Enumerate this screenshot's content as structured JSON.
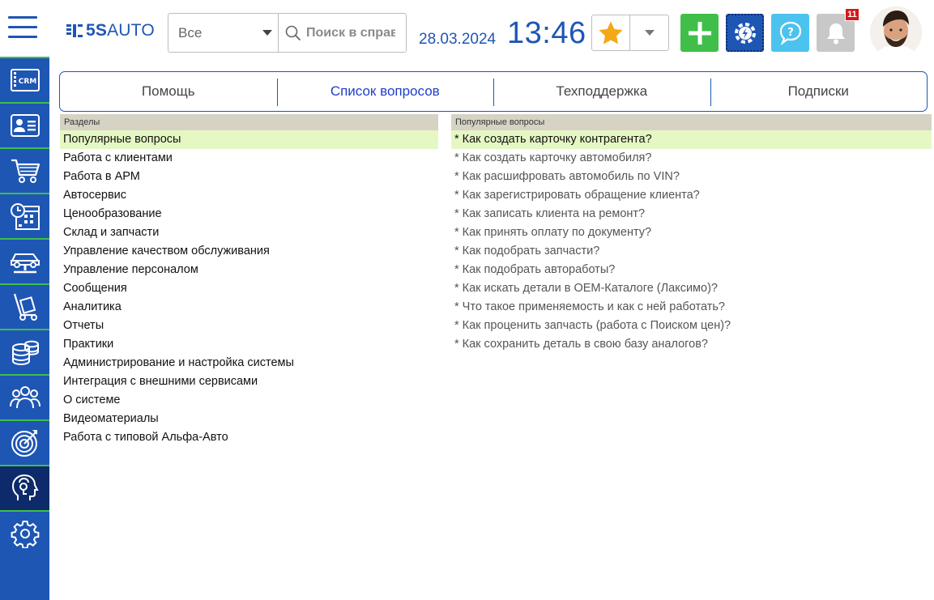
{
  "header": {
    "logo_text_bold": "5S",
    "logo_text": "AUTO",
    "search_scope": "Все",
    "search_placeholder": "Поиск в справке",
    "date": "28.03.2024",
    "time": "13:46",
    "notifications_count": "11"
  },
  "icons": {
    "menu": "hamburger-menu-icon",
    "favorite": "star-icon",
    "add": "plus-icon",
    "eco": "gear-bolt-icon",
    "help": "help-bubble-icon",
    "notifications": "bell-icon"
  },
  "sidebar": {
    "items": [
      {
        "icon": "crm-icon",
        "label": "CRM"
      },
      {
        "icon": "contact-card-icon"
      },
      {
        "icon": "cart-icon"
      },
      {
        "icon": "calendar-clock-icon"
      },
      {
        "icon": "car-lift-icon"
      },
      {
        "icon": "parts-cart-icon"
      },
      {
        "icon": "coins-icon"
      },
      {
        "icon": "team-icon"
      },
      {
        "icon": "target-icon"
      },
      {
        "icon": "support-head-icon"
      },
      {
        "icon": "settings-icon"
      }
    ]
  },
  "tabs": [
    {
      "label": "Помощь"
    },
    {
      "label": "Список вопросов"
    },
    {
      "label": "Техподдержка"
    },
    {
      "label": "Подписки"
    }
  ],
  "sections": {
    "header": "Разделы",
    "items": [
      "Популярные вопросы",
      "Работа с клиентами",
      "Работа в АРМ",
      "Автосервис",
      "Ценообразование",
      "Склад и запчасти",
      "Управление качеством обслуживания",
      "Управление персоналом",
      "Сообщения",
      "Аналитика",
      "Отчеты",
      "Практики",
      "Администрирование и настройка системы",
      "Интеграция с внешними сервисами",
      "О системе",
      "Видеоматериалы",
      "Работа с типовой Альфа-Авто"
    ]
  },
  "questions": {
    "header": "Популярные вопросы",
    "items": [
      "* Как создать карточку контрагента?",
      "* Как создать карточку автомобиля?",
      "* Как расшифровать автомобиль по VIN?",
      "* Как зарегистрировать обращение клиента?",
      "* Как записать клиента на ремонт?",
      "* Как принять оплату по документу?",
      "* Как подобрать запчасти?",
      "* Как подобрать автоработы?",
      "* Как искать детали в ОЕМ-Каталоге (Лаксимо)?",
      "* Что такое применяемость и как с ней работать?",
      "* Как проценить запчасть (работа с Поиском цен)?",
      "* Как сохранить деталь в свою базу аналогов?"
    ]
  },
  "colors": {
    "brand_blue": "#1e56b4",
    "accent_green": "#3fbf4a",
    "selected_row": "#e5f8c4",
    "panel_header": "#d6d3c5"
  }
}
